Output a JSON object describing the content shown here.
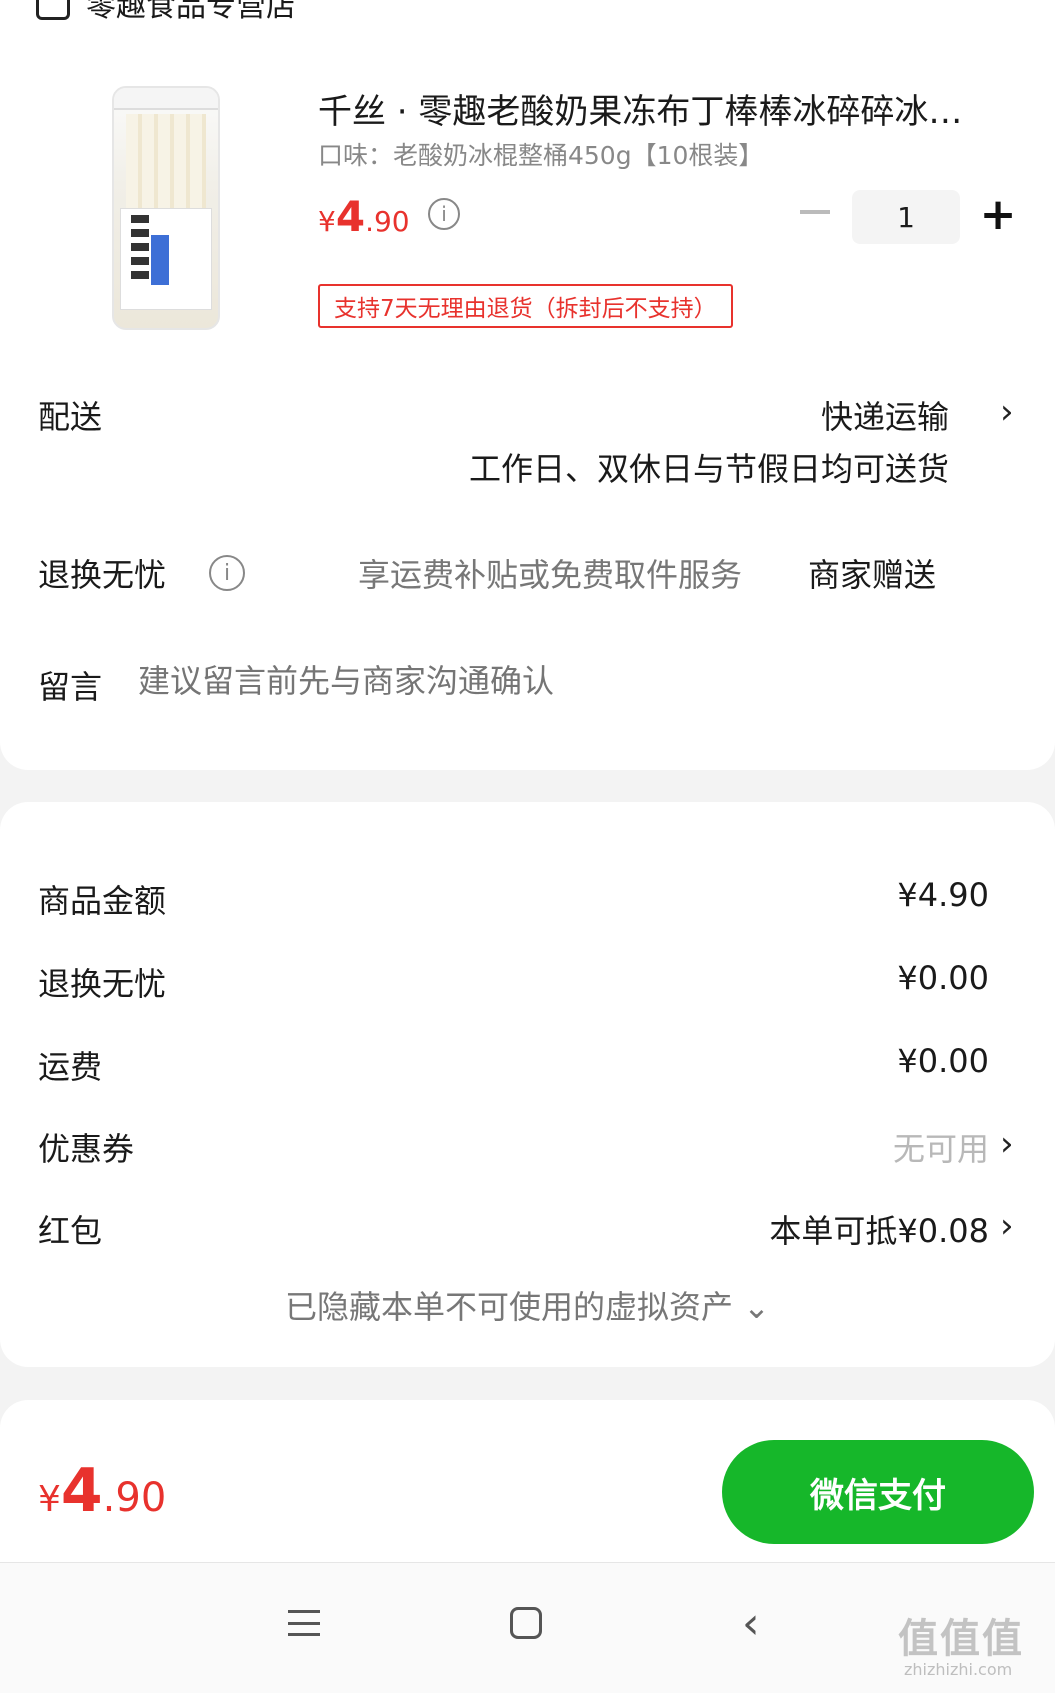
{
  "shop": {
    "name": "零趣食品专营店"
  },
  "product": {
    "title": "千丝 · 零趣老酸奶果冻布丁棒棒冰碎碎冰…",
    "spec": "口味：老酸奶冰棍整桶450g【10根装】",
    "price_currency": "¥",
    "price_int": "4",
    "price_dec": ".90",
    "quantity": "1",
    "return_tag": "支持7天无理由退货（拆封后不支持）"
  },
  "delivery": {
    "label": "配送",
    "value": "快递运输",
    "sub": "工作日、双休日与节假日均可送货"
  },
  "return_service": {
    "label": "退换无忧",
    "desc": "享运费补贴或免费取件服务",
    "value": "商家赠送"
  },
  "note": {
    "label": "留言",
    "placeholder": "建议留言前先与商家沟通确认"
  },
  "summary": {
    "goods_label": "商品金额",
    "goods_value": "¥4.90",
    "return_label": "退换无忧",
    "return_value": "¥0.00",
    "shipping_label": "运费",
    "shipping_value": "¥0.00",
    "coupon_label": "优惠券",
    "coupon_value": "无可用",
    "redpacket_label": "红包",
    "redpacket_value": "本单可抵¥0.08",
    "hidden_assets": "已隐藏本单不可使用的虚拟资产 ⌄"
  },
  "footer": {
    "total_currency": "¥",
    "total_int": "4",
    "total_dec": ".90",
    "pay_label": "微信支付"
  },
  "watermark": {
    "text": "值值值",
    "sub": "zhizhizhi.com"
  },
  "colors": {
    "price_red": "#e8322d",
    "pay_green": "#16b72a"
  },
  "icons": [
    "shop-icon",
    "info-icon",
    "minus-icon",
    "plus-icon",
    "chevron-right-icon",
    "menu-icon",
    "home-icon",
    "back-icon"
  ]
}
